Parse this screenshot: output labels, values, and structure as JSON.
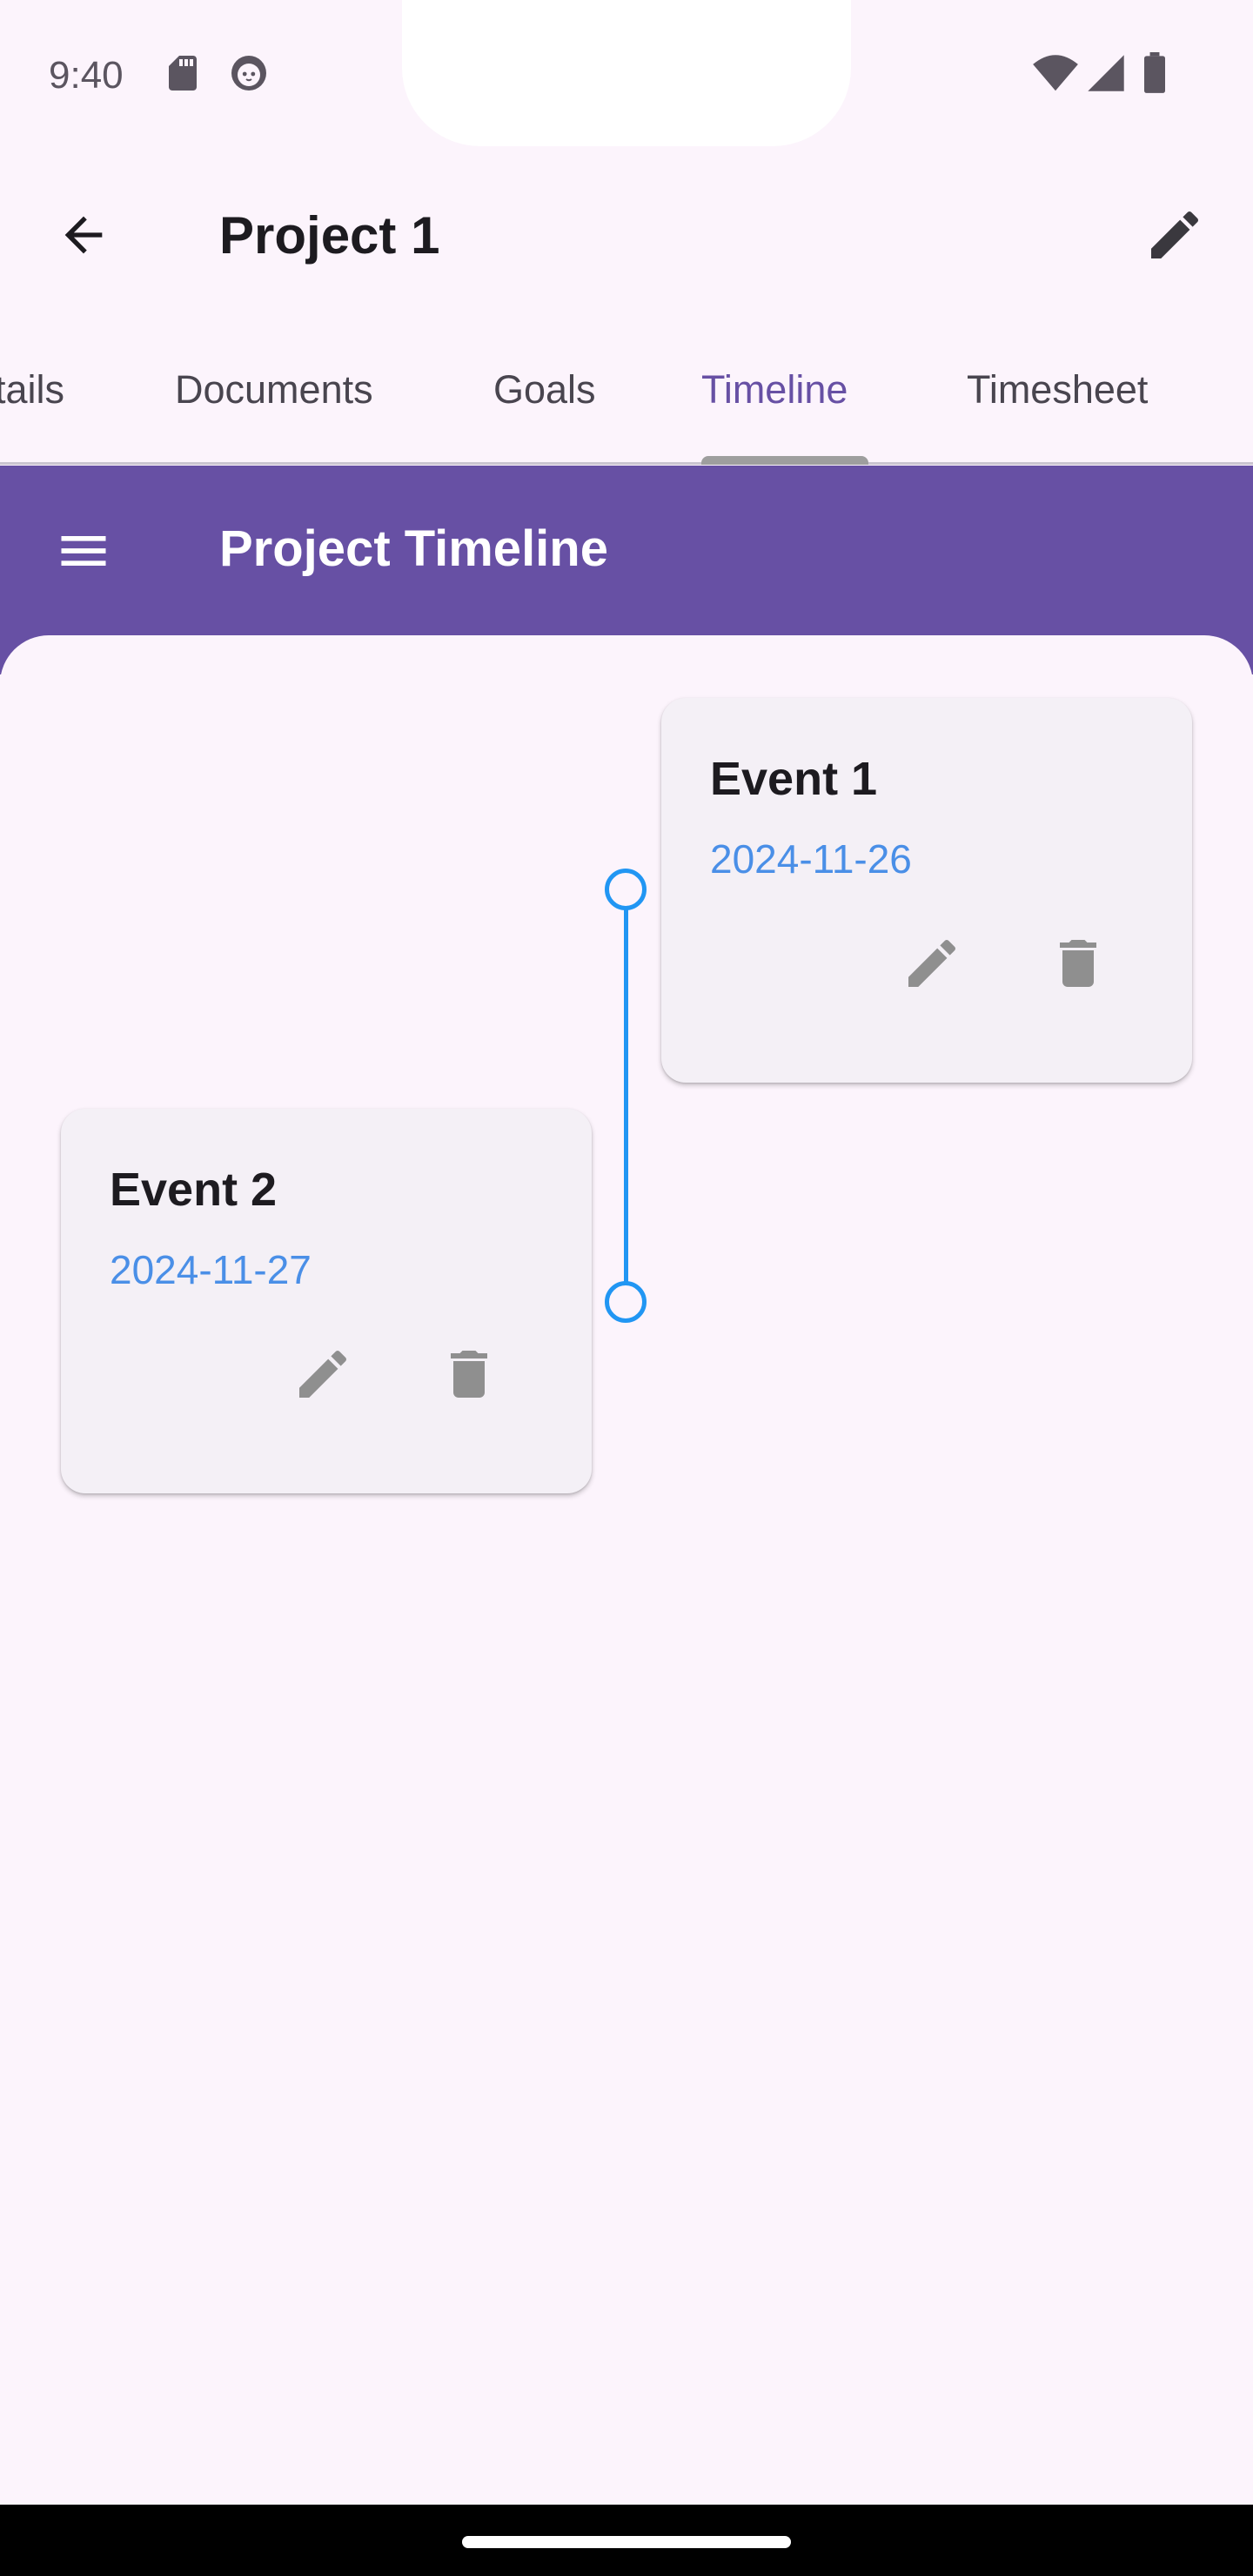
{
  "status_bar": {
    "time": "9:40",
    "icons": [
      "sd-card-icon",
      "cat-face-icon",
      "wifi-icon",
      "cell-signal-icon",
      "battery-icon"
    ]
  },
  "app_bar": {
    "title": "Project 1",
    "back_icon": "arrow-back-icon",
    "edit_icon": "pencil-icon"
  },
  "tabs": [
    {
      "label": "tails"
    },
    {
      "label": "Documents"
    },
    {
      "label": "Goals"
    },
    {
      "label": "Timeline",
      "active": true
    },
    {
      "label": "Timesheet"
    }
  ],
  "section": {
    "title": "Project Timeline",
    "menu_icon": "hamburger-menu-icon",
    "color": "#6750a4"
  },
  "timeline": {
    "accent": "#2196f3",
    "events": [
      {
        "title": "Event 1",
        "date": "2024-11-26",
        "side": "right"
      },
      {
        "title": "Event 2",
        "date": "2024-11-27",
        "side": "left"
      }
    ]
  }
}
